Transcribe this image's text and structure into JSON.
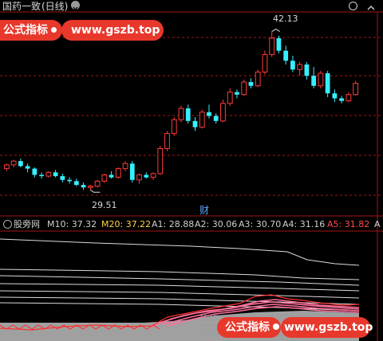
{
  "header": {
    "title": "国药一致",
    "period": "(日线)",
    "chevron_icon": "chevron-down-icon",
    "close_icon": "circle-icon",
    "collapse_icon": "chevron-up-icon"
  },
  "watermark_top": {
    "label": "公式指标",
    "url": "www.gszb.top",
    "dot_icon": "dot-icon"
  },
  "watermark_bottom": {
    "label": "公式指标",
    "url": "www.gszb.top",
    "dot_icon": "dot-icon"
  },
  "annotations": {
    "high": "42.13",
    "low": "29.51",
    "marker": "财"
  },
  "indicator": {
    "name": "股旁网",
    "m10": "M10: 37.32",
    "m20": "M20: 37.22",
    "a1": "A1: 28.88",
    "a2": "A2: 30.06",
    "a3": "A3: 30.70",
    "a4": "A4: 31.16",
    "a5": "A5: 31.82",
    "a_trail": "A"
  },
  "colors": {
    "up": "#ff3b3b",
    "down": "#34f0ff",
    "m20": "#ffd24a",
    "a5": "#ff4d4d",
    "grid": "#a31414",
    "pill": "#e8382c"
  },
  "chart_data": {
    "type": "candlestick",
    "price_range": [
      28.0,
      43.5
    ],
    "candles": [
      [
        31.2,
        31.6,
        31.0,
        31.5
      ],
      [
        31.5,
        31.9,
        31.3,
        31.8
      ],
      [
        31.8,
        32.0,
        31.3,
        31.4
      ],
      [
        31.4,
        31.6,
        30.9,
        31.2
      ],
      [
        31.2,
        31.3,
        30.5,
        30.7
      ],
      [
        30.7,
        30.9,
        30.4,
        30.6
      ],
      [
        30.6,
        31.0,
        30.5,
        30.9
      ],
      [
        30.9,
        31.1,
        30.5,
        30.6
      ],
      [
        30.6,
        30.8,
        30.1,
        30.3
      ],
      [
        30.3,
        30.5,
        30.0,
        30.2
      ],
      [
        30.2,
        30.4,
        29.8,
        29.9
      ],
      [
        29.9,
        30.1,
        29.5,
        29.7
      ],
      [
        29.7,
        29.9,
        29.51,
        29.8
      ],
      [
        29.8,
        30.3,
        29.7,
        30.2
      ],
      [
        30.2,
        30.8,
        30.1,
        30.7
      ],
      [
        30.7,
        31.0,
        30.4,
        30.5
      ],
      [
        30.5,
        31.3,
        30.4,
        31.2
      ],
      [
        31.2,
        31.8,
        31.0,
        31.6
      ],
      [
        31.6,
        31.8,
        30.1,
        30.3
      ],
      [
        30.3,
        30.8,
        30.0,
        30.7
      ],
      [
        30.7,
        30.9,
        30.4,
        30.5
      ],
      [
        30.5,
        30.9,
        30.3,
        30.8
      ],
      [
        30.8,
        33.0,
        30.7,
        32.8
      ],
      [
        32.8,
        34.2,
        32.6,
        34.0
      ],
      [
        34.0,
        35.3,
        33.8,
        35.1
      ],
      [
        35.1,
        36.2,
        34.9,
        36.0
      ],
      [
        36.0,
        36.3,
        34.8,
        35.0
      ],
      [
        35.0,
        35.3,
        34.2,
        34.5
      ],
      [
        34.5,
        35.9,
        34.4,
        35.7
      ],
      [
        35.7,
        36.3,
        35.2,
        35.4
      ],
      [
        35.4,
        35.6,
        34.8,
        35.0
      ],
      [
        35.0,
        36.7,
        34.9,
        36.4
      ],
      [
        36.4,
        37.6,
        36.2,
        37.3
      ],
      [
        37.3,
        37.5,
        36.8,
        37.1
      ],
      [
        37.1,
        38.3,
        37.0,
        38.1
      ],
      [
        38.1,
        38.4,
        37.6,
        37.8
      ],
      [
        37.8,
        39.1,
        37.7,
        38.9
      ],
      [
        38.9,
        40.6,
        38.7,
        40.3
      ],
      [
        40.3,
        42.13,
        40.1,
        41.6
      ],
      [
        41.6,
        41.8,
        40.4,
        40.6
      ],
      [
        40.6,
        41.0,
        39.5,
        39.8
      ],
      [
        39.8,
        40.2,
        38.9,
        39.1
      ],
      [
        39.1,
        39.7,
        38.6,
        39.5
      ],
      [
        39.5,
        39.7,
        38.3,
        38.6
      ],
      [
        38.6,
        39.3,
        37.6,
        37.8
      ],
      [
        37.8,
        39.0,
        37.6,
        38.8
      ],
      [
        38.8,
        39.0,
        36.9,
        37.2
      ],
      [
        37.2,
        37.5,
        36.5,
        36.8
      ],
      [
        36.8,
        37.0,
        36.4,
        36.6
      ],
      [
        36.6,
        37.3,
        36.5,
        37.1
      ],
      [
        37.1,
        38.2,
        37.0,
        38.0
      ]
    ]
  }
}
